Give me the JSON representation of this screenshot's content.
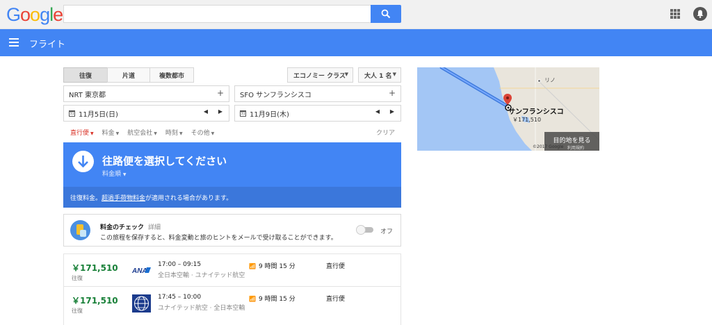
{
  "header": {
    "logo_text": "Google",
    "logo_colors": [
      "#4285f4",
      "#ea4335",
      "#fbbc05",
      "#4285f4",
      "#34a853",
      "#ea4335"
    ],
    "search_value": "",
    "search_icon": "search-icon",
    "apps_icon": "apps-grid-icon",
    "notifications_icon": "notifications-icon"
  },
  "nav": {
    "title": "フライト",
    "menu_icon": "hamburger-menu-icon",
    "color": "#4285f4"
  },
  "trip_type": {
    "options": [
      "往復",
      "片道",
      "複数都市"
    ],
    "selected": "往復"
  },
  "cabin_class": "エコノミー クラス",
  "passengers": "大人 1 名",
  "origin": "NRT 東京都",
  "destination": "SFO サンフランシスコ",
  "depart_date": "11月5日(日)",
  "return_date": "11月9日(木)",
  "filters": {
    "items": [
      "直行便",
      "料金",
      "航空会社",
      "時刻",
      "その他"
    ],
    "clear_label": "クリア",
    "active_color": "#d93025"
  },
  "select_panel": {
    "heading": "往路便を選択してください",
    "sort_label": "料金順",
    "notice_prefix": "往復料金。",
    "notice_link": "超過手荷物料金",
    "notice_suffix": "が適用される場合があります。"
  },
  "price_tracking": {
    "title": "料金のチェック",
    "details_link": "詳細",
    "description": "この旅程を保存すると、料金変動と旅のヒントをメールで受け取ることができます。",
    "toggle_label": "オフ",
    "toggle_on": false
  },
  "flights": [
    {
      "price": "￥171,510",
      "price_type": "往復",
      "airline_logo": "ana-logo",
      "time": "17:00 – 09:15",
      "airlines": "全日本空輸 · ユナイテッド航空",
      "duration": "9 時間 15 分",
      "stops": "直行便"
    },
    {
      "price": "￥171,510",
      "price_type": "往復",
      "airline_logo": "united-logo",
      "time": "17:45 – 10:00",
      "airlines": "ユナイテッド航空 · 全日本空輸",
      "duration": "9 時間 15 分",
      "stops": "直行便"
    }
  ],
  "map": {
    "destination_city": "サンフランシスコ",
    "destination_price": "￥171,510",
    "nearby_city": "リノ",
    "view_button": "目的地を見る",
    "copyright": "©2017 Google",
    "terms": "利用規約"
  }
}
